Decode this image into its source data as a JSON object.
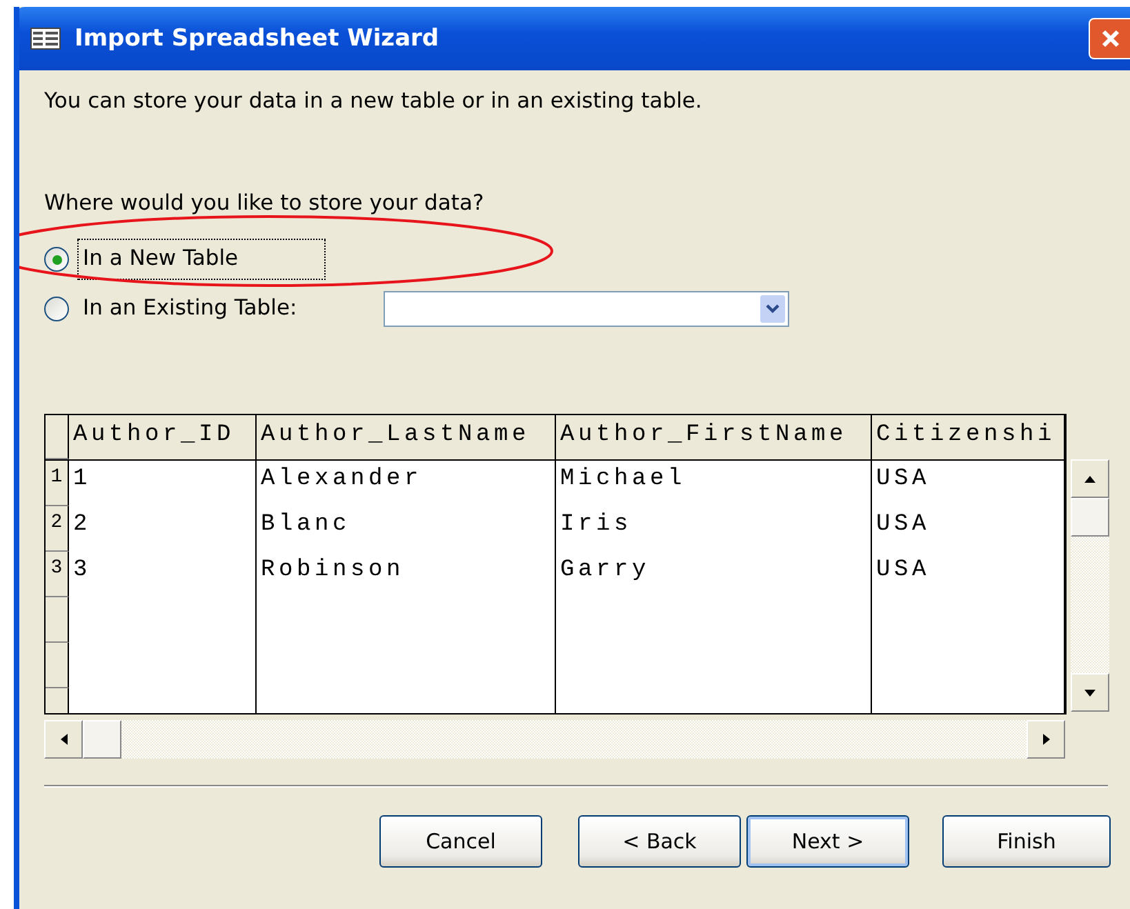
{
  "window": {
    "title": "Import Spreadsheet Wizard"
  },
  "intro": "You can store your data in a new table or in an existing table.",
  "question": "Where would you like to store your data?",
  "options": [
    {
      "label": "In a New Table",
      "selected": true,
      "focused": true,
      "kind": "plain"
    },
    {
      "label": "In an Existing Table:",
      "selected": false,
      "focused": false,
      "kind": "with-dropdown"
    }
  ],
  "preview": {
    "columns": [
      "Author_ID",
      "Author_LastName",
      "Author_FirstName",
      "Citizenshi"
    ],
    "rows": [
      {
        "number": "1",
        "cells": [
          "1",
          "Alexander",
          "Michael",
          "USA"
        ]
      },
      {
        "number": "2",
        "cells": [
          "2",
          "Blanc",
          "Iris",
          "USA"
        ]
      },
      {
        "number": "3",
        "cells": [
          "3",
          "Robinson",
          "Garry",
          "USA"
        ]
      }
    ]
  },
  "annotation": {
    "kind": "ellipse"
  },
  "buttons": [
    {
      "label": "Cancel",
      "default": false
    },
    {
      "label": "< Back",
      "default": false
    },
    {
      "label": "Next >",
      "default": true
    },
    {
      "label": "Finish",
      "default": false
    }
  ]
}
